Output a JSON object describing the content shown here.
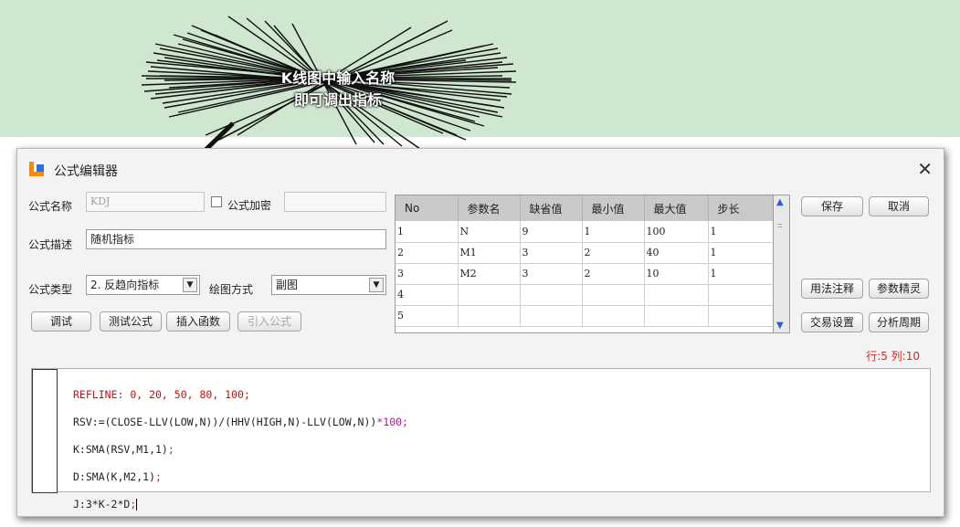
{
  "callout": {
    "line1": "K线图中输入名称",
    "line2": "即可调出指标"
  },
  "dialog": {
    "title": "公式编辑器",
    "close_symbol": "✕",
    "name_label": "公式名称",
    "name_value": "KDJ",
    "encrypt_label": "公式加密",
    "desc_label": "公式描述",
    "desc_value": "随机指标",
    "type_label": "公式类型",
    "type_value": "2. 反趋向指标",
    "draw_label": "绘图方式",
    "draw_value": "副图",
    "buttons": {
      "debug": "调试",
      "test": "测试公式",
      "insert_func": "插入函数",
      "import": "引入公式",
      "save": "保存",
      "cancel": "取消",
      "usage": "用法注释",
      "param_wizard": "参数精灵",
      "trade_settings": "交易设置",
      "analysis_period": "分析周期"
    },
    "params_table": {
      "headers": [
        "No",
        "参数名",
        "缺省值",
        "最小值",
        "最大值",
        "步长"
      ],
      "rows": [
        [
          "1",
          "N",
          "9",
          "1",
          "100",
          "1"
        ],
        [
          "2",
          "M1",
          "3",
          "2",
          "40",
          "1"
        ],
        [
          "3",
          "M2",
          "3",
          "2",
          "10",
          "1"
        ],
        [
          "4",
          "",
          "",
          "",
          "",
          ""
        ],
        [
          "5",
          "",
          "",
          "",
          "",
          ""
        ]
      ]
    },
    "status": "行:5 列:10",
    "code": {
      "line1_kw": "REFLINE",
      "line1_rest": ": 0, 20, 50, 80, 100;",
      "line2_main": "RSV:=(CLOSE-LLV(LOW,N))/(HHV(HIGH,N)-LLV(LOW,N))",
      "line2_tail": "*100;",
      "line3_main": "K:SMA(RSV,M1,1)",
      "line3_tail": ";",
      "line4_main": "D:SMA(K,M2,1)",
      "line4_tail": ";",
      "line5_main": "J:3*K-2*D",
      "line5_tail": ";"
    }
  },
  "colors": {
    "banner": "#cfe6cf",
    "keyword": "#c01010",
    "operator": "#c0109a",
    "status": "#dd2222",
    "icon_orange": "#f08a1c",
    "icon_blue": "#2d6fd6"
  }
}
